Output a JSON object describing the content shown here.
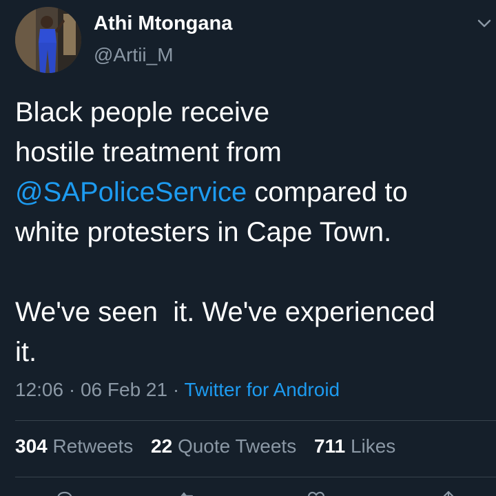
{
  "user": {
    "name": "Athi Mtongana",
    "handle": "@Artii_M"
  },
  "tweet": {
    "line1": "Black people receive",
    "line2": "hostile treatment from",
    "mention": "@SAPoliceService",
    "line3_rest": " compared to",
    "line4": "white protesters in Cape Town.",
    "line5": "We've seen  it. We've experienced",
    "line6": "it."
  },
  "meta": {
    "time": "12:06",
    "sep1": " · ",
    "date": "06 Feb 21",
    "sep2": " · ",
    "source": "Twitter for Android"
  },
  "stats": {
    "retweets_count": "304",
    "retweets_label": "Retweets",
    "quotes_count": "22",
    "quotes_label": "Quote Tweets",
    "likes_count": "711",
    "likes_label": "Likes"
  },
  "colors": {
    "background": "#151f2a",
    "link": "#1d9bf0",
    "muted": "#8b98a5",
    "divider": "#38444d"
  },
  "icons": {
    "menu": "chevron-down-icon",
    "reply": "reply-icon",
    "retweet": "retweet-icon",
    "like": "heart-icon",
    "share": "share-icon"
  }
}
